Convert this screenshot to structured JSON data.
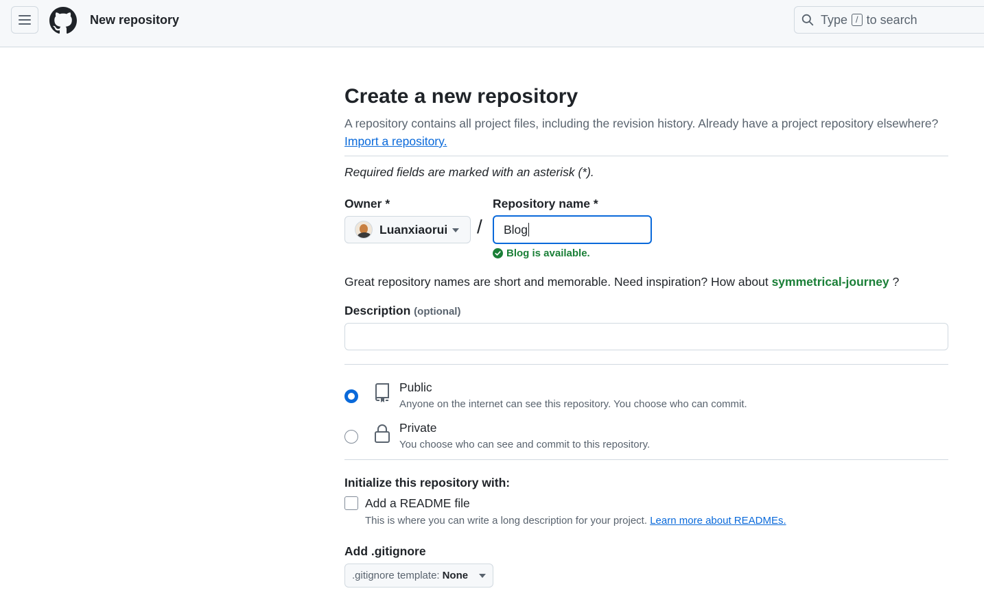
{
  "header": {
    "title": "New repository",
    "search": {
      "before": "Type",
      "key": "/",
      "after": "to search"
    }
  },
  "page": {
    "heading": "Create a new repository",
    "lead": "A repository contains all project files, including the revision history. Already have a project repository elsewhere?",
    "import_link": "Import a repository.",
    "required_note": "Required fields are marked with an asterisk (*)."
  },
  "owner": {
    "label": "Owner *",
    "value": "Luanxiaorui"
  },
  "repo": {
    "label": "Repository name *",
    "value": "Blog",
    "availability": "Blog is available."
  },
  "hint": {
    "text": "Great repository names are short and memorable. Need inspiration? How about",
    "suggestion": "symmetrical-journey",
    "suffix": "?"
  },
  "description": {
    "label": "Description",
    "optional": "(optional)",
    "value": ""
  },
  "visibility": {
    "selected": "public",
    "options": [
      {
        "title": "Public",
        "desc": "Anyone on the internet can see this repository. You choose who can commit."
      },
      {
        "title": "Private",
        "desc": "You choose who can see and commit to this repository."
      }
    ]
  },
  "initialize": {
    "heading": "Initialize this repository with:",
    "readme_label": "Add a README file",
    "readme_checked": false,
    "readme_desc": "This is where you can write a long description for your project.",
    "readme_link": "Learn more about READMEs."
  },
  "gitignore": {
    "heading": "Add .gitignore",
    "prefix": ".gitignore template:",
    "value": "None"
  },
  "colors": {
    "accent": "#0969da",
    "success": "#1a7f37",
    "border": "#d1d9e0",
    "muted": "#59636e"
  }
}
